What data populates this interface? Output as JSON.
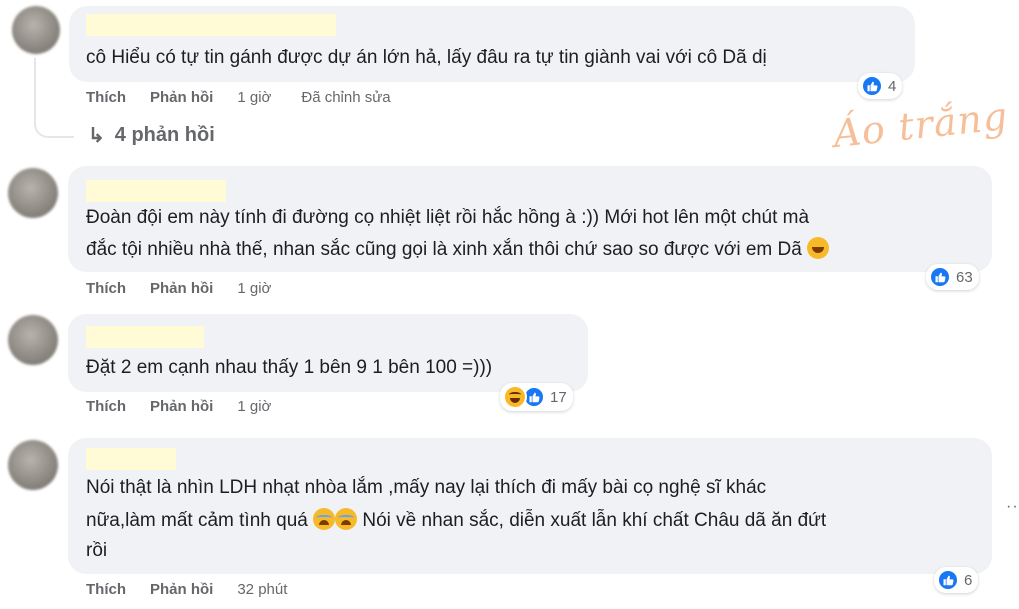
{
  "watermark": "Áo trắng",
  "actions": {
    "like": "Thích",
    "reply": "Phản hồi"
  },
  "comments": [
    {
      "text_lines": [
        "cô Hiểu có tự tin gánh được dự án lớn hả, lấy đâu ra tự tin giành vai với cô Dã dị"
      ],
      "time": "1 giờ",
      "edited": "Đã chỉnh sửa",
      "reactions": [
        "like-icon"
      ],
      "reaction_count": "4",
      "replies_label": "4 phản hồi"
    },
    {
      "text_lines": [
        "Đoàn đội em này tính đi đường cọ nhiệt liệt rồi hắc hồng à :)) Mới hot lên một chút mà",
        "đắc tội nhiều nhà thế, nhan sắc cũng gọi là xinh xắn thôi chứ sao so được với em Dã"
      ],
      "time": "1 giờ",
      "reactions": [
        "like-icon"
      ],
      "reaction_count": "63"
    },
    {
      "text_lines": [
        "Đặt 2 em cạnh nhau thấy 1 bên 9 1 bên 100 =)))"
      ],
      "time": "1 giờ",
      "reactions": [
        "haha-icon",
        "like-icon"
      ],
      "reaction_count": "17"
    },
    {
      "text_lines": [
        "Nói thật là nhìn LDH nhạt nhòa lắm ,mấy nay lại thích đi mấy bài cọ nghệ sĩ khác",
        "nữa,làm mất cảm tình quá",
        "Nói về nhan sắc, diễn xuất lẫn khí chất Châu dã ăn đứt",
        "rồi"
      ],
      "time": "32 phút",
      "reactions": [
        "like-icon"
      ],
      "reaction_count": "6"
    }
  ]
}
